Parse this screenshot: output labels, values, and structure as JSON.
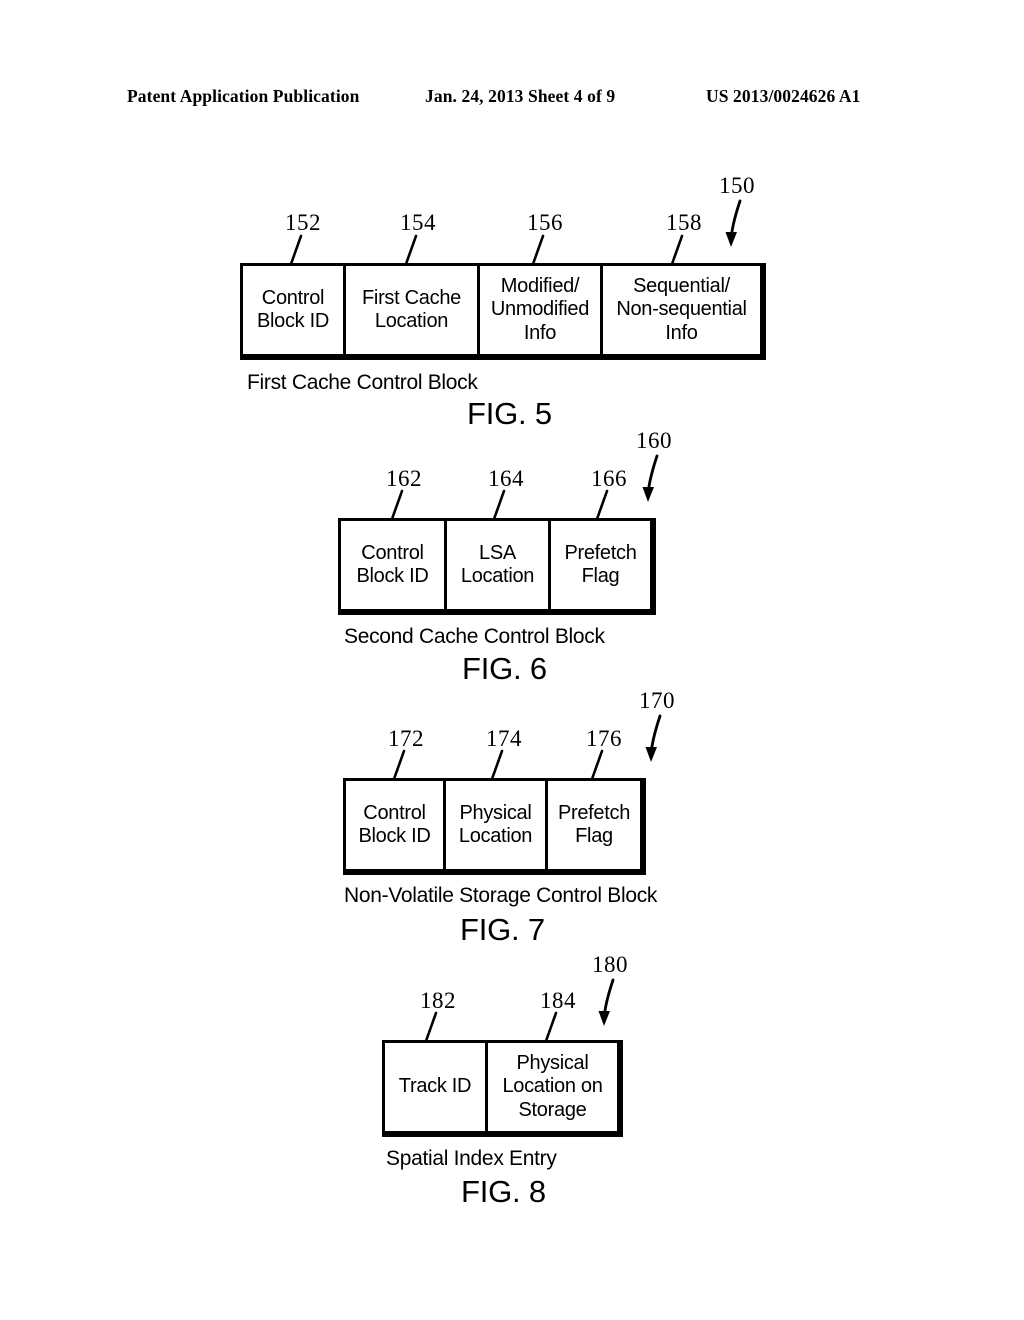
{
  "header": {
    "publication": "Patent Application Publication",
    "date_sheet": "Jan. 24, 2013  Sheet 4 of 9",
    "publication_number": "US 2013/0024626 A1"
  },
  "figures": [
    {
      "id": "fig5",
      "block_ref": "150",
      "caption": "First Cache Control Block",
      "label": "FIG. 5",
      "cells": [
        {
          "ref": "152",
          "lines": [
            "Control",
            "Block ID"
          ]
        },
        {
          "ref": "154",
          "lines": [
            "First Cache",
            "Location"
          ]
        },
        {
          "ref": "156",
          "lines": [
            "Modified/",
            "Unmodified",
            "Info"
          ]
        },
        {
          "ref": "158",
          "lines": [
            "Sequential/",
            "Non-sequential",
            "Info"
          ]
        }
      ]
    },
    {
      "id": "fig6",
      "block_ref": "160",
      "caption": "Second Cache Control Block",
      "label": "FIG. 6",
      "cells": [
        {
          "ref": "162",
          "lines": [
            "Control",
            "Block ID"
          ]
        },
        {
          "ref": "164",
          "lines": [
            "LSA",
            "Location"
          ]
        },
        {
          "ref": "166",
          "lines": [
            "Prefetch",
            "Flag"
          ]
        }
      ]
    },
    {
      "id": "fig7",
      "block_ref": "170",
      "caption": "Non-Volatile Storage Control Block",
      "label": "FIG. 7",
      "cells": [
        {
          "ref": "172",
          "lines": [
            "Control",
            "Block ID"
          ]
        },
        {
          "ref": "174",
          "lines": [
            "Physical",
            "Location"
          ]
        },
        {
          "ref": "176",
          "lines": [
            "Prefetch",
            "Flag"
          ]
        }
      ]
    },
    {
      "id": "fig8",
      "block_ref": "180",
      "caption": "Spatial Index Entry",
      "label": "FIG. 8",
      "cells": [
        {
          "ref": "182",
          "lines": [
            "Track ID"
          ]
        },
        {
          "ref": "184",
          "lines": [
            "Physical",
            "Location on",
            "Storage"
          ]
        }
      ]
    }
  ]
}
